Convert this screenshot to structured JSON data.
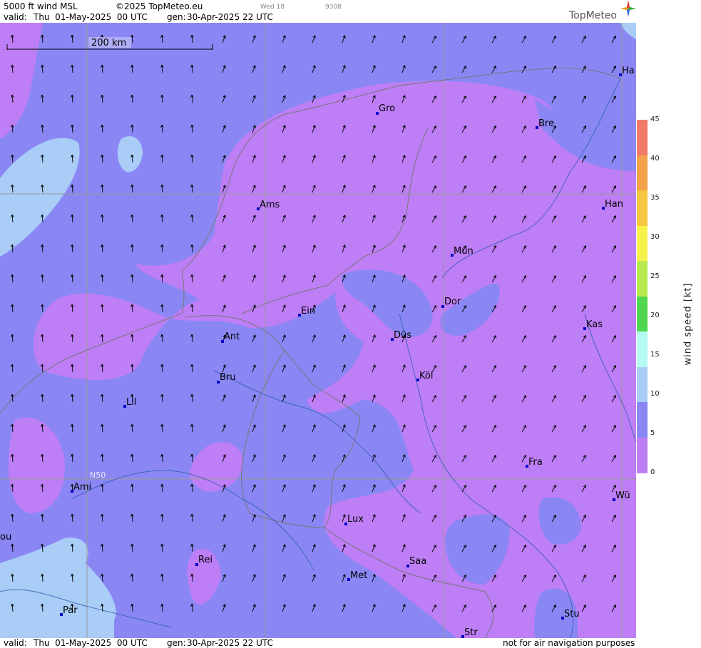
{
  "header": {
    "product": "5000 ft wind MSL",
    "copyright": "©2025 TopMeteo.eu",
    "valid_label": "valid:",
    "valid_time": "Thu  01-May-2025  00 UTC",
    "gen_label": "gen:",
    "gen_time": "30-Apr-2025 22 UTC",
    "faint_day": "Wed 18",
    "faint_code": "9308",
    "logo": "TopMeteo"
  },
  "footer": {
    "valid_label": "valid:",
    "valid_time": "Thu  01-May-2025  00 UTC",
    "gen_label": "gen:",
    "gen_time": "30-Apr-2025 22 UTC",
    "disclaimer": "not for air navigation purposes"
  },
  "map": {
    "scale_label": "200 km",
    "lat_label": "N50",
    "cities": [
      {
        "name": "Gro"
      },
      {
        "name": "Bre"
      },
      {
        "name": "Ha"
      },
      {
        "name": "Ams"
      },
      {
        "name": "Han"
      },
      {
        "name": "Mün"
      },
      {
        "name": "Dor"
      },
      {
        "name": "Ein"
      },
      {
        "name": "Ant"
      },
      {
        "name": "Düs"
      },
      {
        "name": "Kas"
      },
      {
        "name": "Bru"
      },
      {
        "name": "Köl"
      },
      {
        "name": "Lil"
      },
      {
        "name": "Fra"
      },
      {
        "name": "Ami"
      },
      {
        "name": "Wü"
      },
      {
        "name": "Lux"
      },
      {
        "name": "ou"
      },
      {
        "name": "Rei"
      },
      {
        "name": "Saa"
      },
      {
        "name": "Met"
      },
      {
        "name": "Par"
      },
      {
        "name": "Stu"
      },
      {
        "name": "Str"
      }
    ]
  },
  "legend": {
    "title": "wind speed [kt]",
    "ticks": [
      "45",
      "40",
      "35",
      "30",
      "25",
      "20",
      "15",
      "10",
      "5",
      "0"
    ],
    "colors": [
      "#f07b66",
      "#f5a04a",
      "#f7c640",
      "#f7f14b",
      "#b6ea4f",
      "#4fd84f",
      "#b6fbf2",
      "#a9cdf7",
      "#8a87f5",
      "#be7ef5"
    ]
  }
}
